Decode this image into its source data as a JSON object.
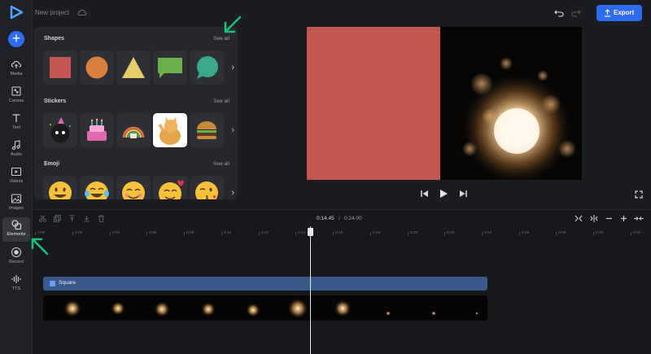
{
  "header": {
    "project_title": "New project",
    "export_label": "Export"
  },
  "rail": {
    "items": [
      {
        "label": "Media"
      },
      {
        "label": "Canvas"
      },
      {
        "label": "Text"
      },
      {
        "label": "Audio"
      },
      {
        "label": "Videos"
      },
      {
        "label": "Images"
      },
      {
        "label": "Elements"
      },
      {
        "label": "Record"
      },
      {
        "label": "TTS"
      }
    ]
  },
  "panel": {
    "sections": [
      {
        "title": "Shapes",
        "see_all": "See all"
      },
      {
        "title": "Stickers",
        "see_all": "See all"
      },
      {
        "title": "Emoji",
        "see_all": "See all"
      }
    ],
    "shapes": [
      "red-square",
      "orange-circle",
      "yellow-triangle",
      "green-speech-bubble",
      "teal-speech-bubble"
    ],
    "emoji": [
      "😀",
      "😂",
      "😊",
      "🥰",
      "😘"
    ]
  },
  "timeline": {
    "current_time": "0:14.45",
    "separator": "/",
    "total_time": "0:24.00",
    "ruler": [
      "0:00",
      "0:02",
      "0:04",
      "0:06",
      "0:08",
      "0:10",
      "0:12",
      "0:14",
      "0:16",
      "0:18",
      "0:20",
      "0:22",
      "0:24",
      "0:26",
      "0:28",
      "0:30",
      "0:32",
      "0:34"
    ],
    "text_track_label": "Square"
  },
  "colors": {
    "accent": "#2e6bf0",
    "square": "#c2574f",
    "circle": "#d9803f",
    "triangle": "#e5cd6a",
    "bubble_green": "#6ab04c",
    "bubble_teal": "#3aa88a",
    "annotation_arrow": "#19c37d"
  }
}
